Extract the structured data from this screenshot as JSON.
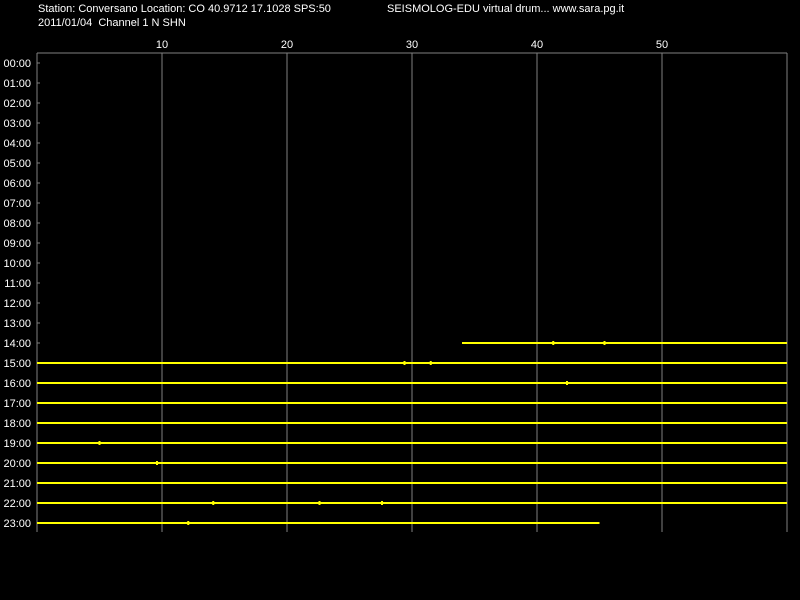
{
  "header": {
    "station_line": "Station: Conversano Location: CO 40.9712 17.1028 SPS:50",
    "title_line": "SEISMOLOG-EDU virtual drum... www.sara.pg.it",
    "date_line": "2011/01/04  Channel 1 N SHN"
  },
  "colors": {
    "background": "#000000",
    "text": "#ffffff",
    "grid": "#808080",
    "trace": "#ffff00"
  },
  "chart_data": {
    "type": "line",
    "title": "",
    "xlabel": "",
    "ylabel": "",
    "xlim": [
      0,
      60
    ],
    "x_ticks": [
      "10",
      "20",
      "30",
      "40",
      "50"
    ],
    "x_tick_values": [
      10,
      20,
      30,
      40,
      50
    ],
    "hours": [
      "00:00",
      "01:00",
      "02:00",
      "03:00",
      "04:00",
      "05:00",
      "06:00",
      "07:00",
      "08:00",
      "09:00",
      "10:00",
      "11:00",
      "12:00",
      "13:00",
      "14:00",
      "15:00",
      "16:00",
      "17:00",
      "18:00",
      "19:00",
      "20:00",
      "21:00",
      "22:00",
      "23:00"
    ],
    "grid": true,
    "traces": [
      {
        "hour": "14:00",
        "start_min": 34,
        "end_min": 60,
        "spikes_min": [
          41.3,
          45.4
        ]
      },
      {
        "hour": "15:00",
        "start_min": 0,
        "end_min": 60,
        "spikes_min": [
          29.4,
          31.5
        ]
      },
      {
        "hour": "16:00",
        "start_min": 0,
        "end_min": 60,
        "spikes_min": [
          42.4
        ]
      },
      {
        "hour": "17:00",
        "start_min": 0,
        "end_min": 60,
        "spikes_min": []
      },
      {
        "hour": "18:00",
        "start_min": 0,
        "end_min": 60,
        "spikes_min": []
      },
      {
        "hour": "19:00",
        "start_min": 0,
        "end_min": 60,
        "spikes_min": [
          5.0
        ]
      },
      {
        "hour": "20:00",
        "start_min": 0,
        "end_min": 60,
        "spikes_min": [
          9.6
        ]
      },
      {
        "hour": "21:00",
        "start_min": 0,
        "end_min": 60,
        "spikes_min": []
      },
      {
        "hour": "22:00",
        "start_min": 0,
        "end_min": 60,
        "spikes_min": [
          14.1,
          22.6,
          27.6
        ]
      },
      {
        "hour": "23:00",
        "start_min": 0,
        "end_min": 45,
        "spikes_min": [
          12.1
        ]
      }
    ]
  }
}
